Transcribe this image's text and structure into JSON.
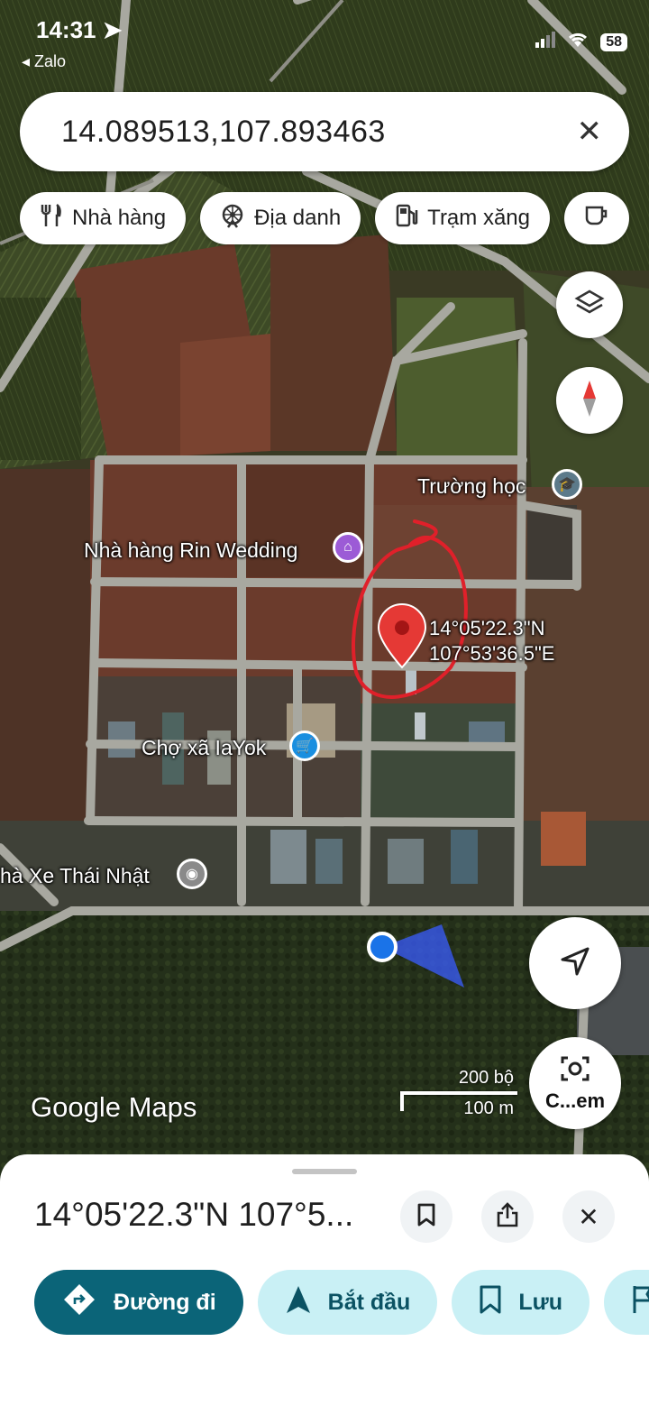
{
  "status": {
    "time": "14:31",
    "back_app": "Zalo",
    "battery": "58"
  },
  "search": {
    "query": "14.089513,107.893463",
    "clear_icon": "close-icon"
  },
  "chips": [
    {
      "label": "Nhà hàng",
      "icon": "restaurant-icon"
    },
    {
      "label": "Địa danh",
      "icon": "attraction-icon"
    },
    {
      "label": "Trạm xăng",
      "icon": "gas-station-icon"
    },
    {
      "label": "",
      "icon": "coffee-icon"
    }
  ],
  "map": {
    "labels": {
      "school": "Trường học",
      "restaurant": "Nhà hàng Rin Wedding",
      "market": "Chợ xã IaYok",
      "bus": "hà Xe Thái Nhật"
    },
    "pin_lat": "14°05'22.3\"N",
    "pin_lng": "107°53'36.5\"E",
    "brand": {
      "google": "Google",
      "maps": "Maps"
    },
    "scale": {
      "imperial": "200 bộ",
      "metric": "100 m"
    },
    "lens_label": "C...em",
    "colors": {
      "road": "#a8a8a0",
      "pin": "#e53935",
      "annotation": "#e0202a",
      "you": "#1a73e8"
    }
  },
  "sheet": {
    "title": "14°05'22.3\"N 107°5...",
    "actions": {
      "directions": "Đường đi",
      "start": "Bắt đầu",
      "save": "Lưu"
    },
    "colors": {
      "primary": "#0b6478",
      "secondary": "#c9f0f5"
    }
  }
}
